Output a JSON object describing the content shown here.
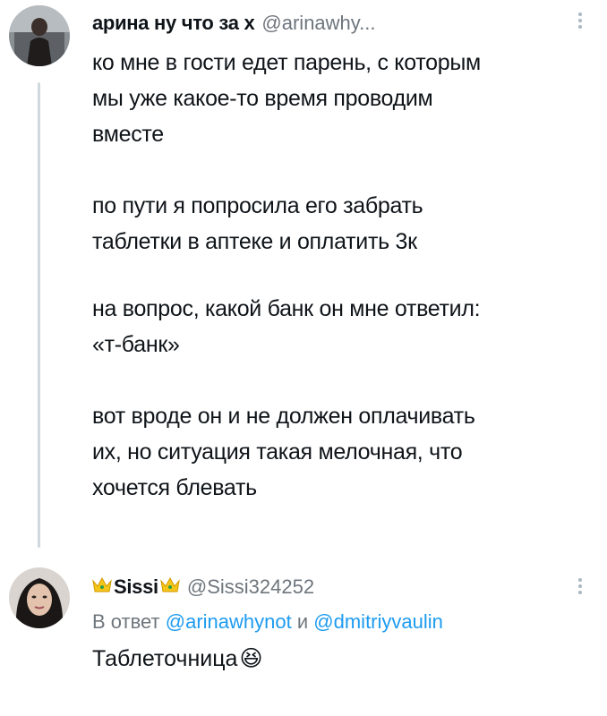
{
  "tweet": {
    "display_name": "арина ну что за х",
    "handle": "@arinawhy...",
    "paragraphs": [
      "ко мне в гости едет парень, с которым\nмы уже какое-то время проводим\nвместе",
      "по пути я попросила его забрать\nтаблетки в аптеке и оплатить 3к",
      "на вопрос, какой банк он мне ответил:\n«т-банк»",
      "вот вроде он и не должен оплачивать\nих, но ситуация такая мелочная, что\nхочется блевать"
    ]
  },
  "reply": {
    "display_name": "Sissi",
    "handle": "@Sissi324252",
    "reply_prefix": "В ответ",
    "mention_1": "@arinawhynot",
    "conjunction": "и",
    "mention_2": "@dmitriyvaulin",
    "text": "Таблеточница",
    "emoji": "😆"
  },
  "colors": {
    "accent": "#1d9bf0",
    "secondary_text": "#6e767d",
    "thread_line": "#cfd9de"
  },
  "icons": [
    "more-options-icon",
    "crown-icon",
    "laughing-emoji-icon"
  ]
}
